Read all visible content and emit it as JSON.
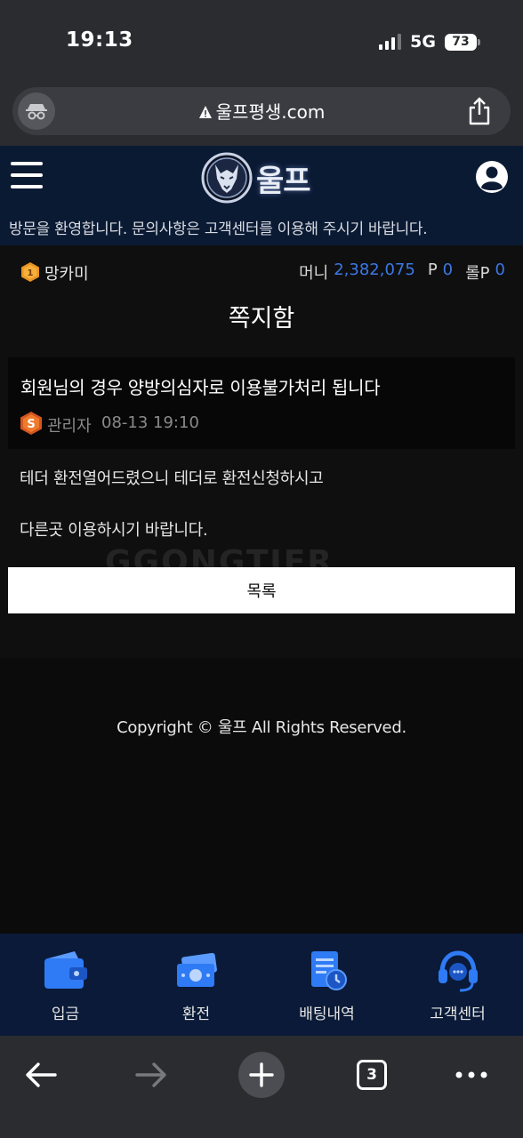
{
  "status_bar": {
    "time": "19:13",
    "network": "5G",
    "battery": "73"
  },
  "browser": {
    "url": "울프평생.com",
    "tab_count": "3"
  },
  "site": {
    "logo_text": "울프",
    "notice": "방문을 환영합니다. 문의사항은 고객센터를 이용해 주시기 바랍니다."
  },
  "user": {
    "level_badge": "1",
    "username": "망카미",
    "money_label": "머니",
    "money_value": "2,382,075",
    "point_label": "P",
    "point_value": "0",
    "rolling_label": "롤P",
    "rolling_value": "0"
  },
  "page": {
    "title": "쪽지함"
  },
  "message": {
    "subject": "회원님의 경우 양방의심자로 이용불가처리 됩니다",
    "sender_badge": "S",
    "sender": "관리자",
    "date": "08-13 19:10",
    "body_line1": "테더 환전열어드렸으니 테더로 환전신청하시고",
    "body_line2": "다른곳 이용하시기 바랍니다."
  },
  "watermark": "GGONGTIER",
  "list_button": "목록",
  "footer": {
    "copyright": "Copyright © 울프 All Rights Reserved."
  },
  "bottom_nav": [
    {
      "label": "입금",
      "icon": "wallet-icon"
    },
    {
      "label": "환전",
      "icon": "cash-icon"
    },
    {
      "label": "배팅내역",
      "icon": "betting-history-icon"
    },
    {
      "label": "고객센터",
      "icon": "headset-icon"
    }
  ],
  "colors": {
    "accent": "#3b78e7",
    "header_bg": "#0b1a33",
    "nav_bg": "#0a1a38",
    "icon_blue": "#2f7bf5"
  }
}
